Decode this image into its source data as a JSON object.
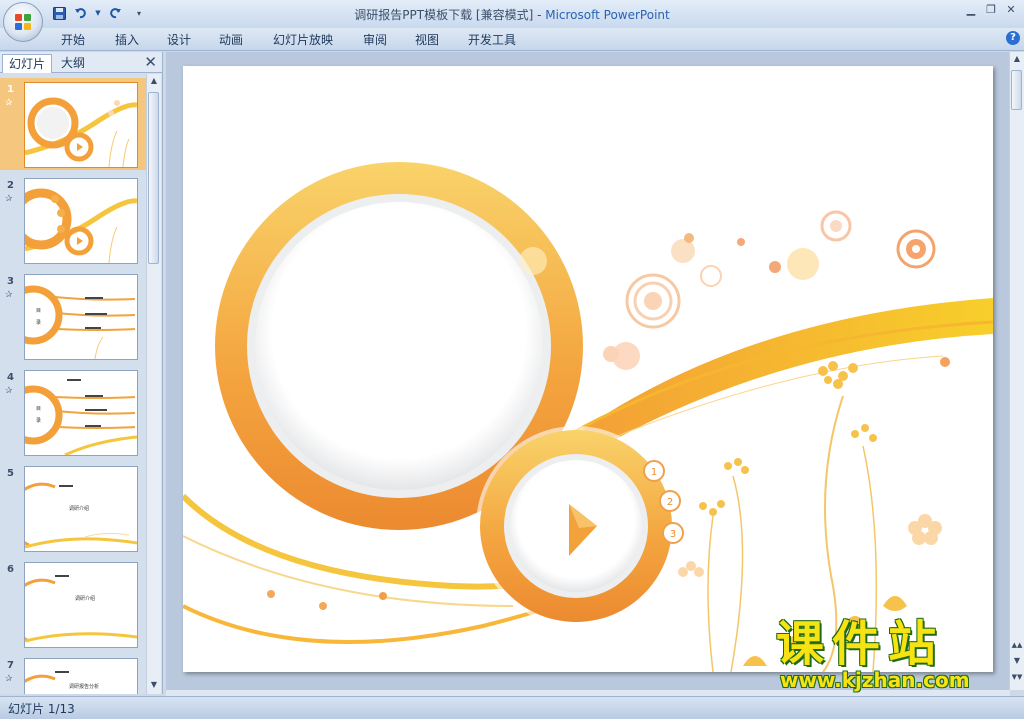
{
  "window": {
    "title_doc": "调研报告PPT模板下载 [兼容模式]",
    "title_sep": " - ",
    "title_app": "Microsoft PowerPoint",
    "minimize_icon": "minimize-icon",
    "restore_icon": "restore-icon",
    "close_icon": "close-icon"
  },
  "quick_access": {
    "save_icon": "save-icon",
    "undo_icon": "undo-icon",
    "redo_icon": "redo-icon",
    "customize_icon": "dropdown-icon"
  },
  "menu": {
    "items": [
      "开始",
      "插入",
      "设计",
      "动画",
      "幻灯片放映",
      "审阅",
      "视图",
      "开发工具"
    ],
    "help_label": "?"
  },
  "left_pane": {
    "tabs": [
      "幻灯片",
      "大纲"
    ],
    "close_label": "✕",
    "thumbnails": [
      {
        "number": "1",
        "selected": true,
        "labels": []
      },
      {
        "number": "2",
        "selected": false,
        "labels": []
      },
      {
        "number": "3",
        "selected": false,
        "labels": [
          "目",
          "录"
        ]
      },
      {
        "number": "4",
        "selected": false,
        "labels": [
          "目",
          "录"
        ]
      },
      {
        "number": "5",
        "selected": false,
        "labels": [
          "调研介绍"
        ]
      },
      {
        "number": "6",
        "selected": false,
        "labels": [
          "调研介绍"
        ]
      },
      {
        "number": "7",
        "selected": false,
        "labels": [
          "调研报告分析"
        ]
      }
    ]
  },
  "slide": {
    "badges": [
      "1",
      "2",
      "3"
    ]
  },
  "status": {
    "slide_indicator": "幻灯片 1/13"
  },
  "watermark": {
    "main": "课件站",
    "url": "www.kjzhan.com"
  },
  "colors": {
    "accent_orange": "#f08c2c",
    "accent_yellow": "#f7c948",
    "ribbon_blue": "#c6d6eb"
  }
}
